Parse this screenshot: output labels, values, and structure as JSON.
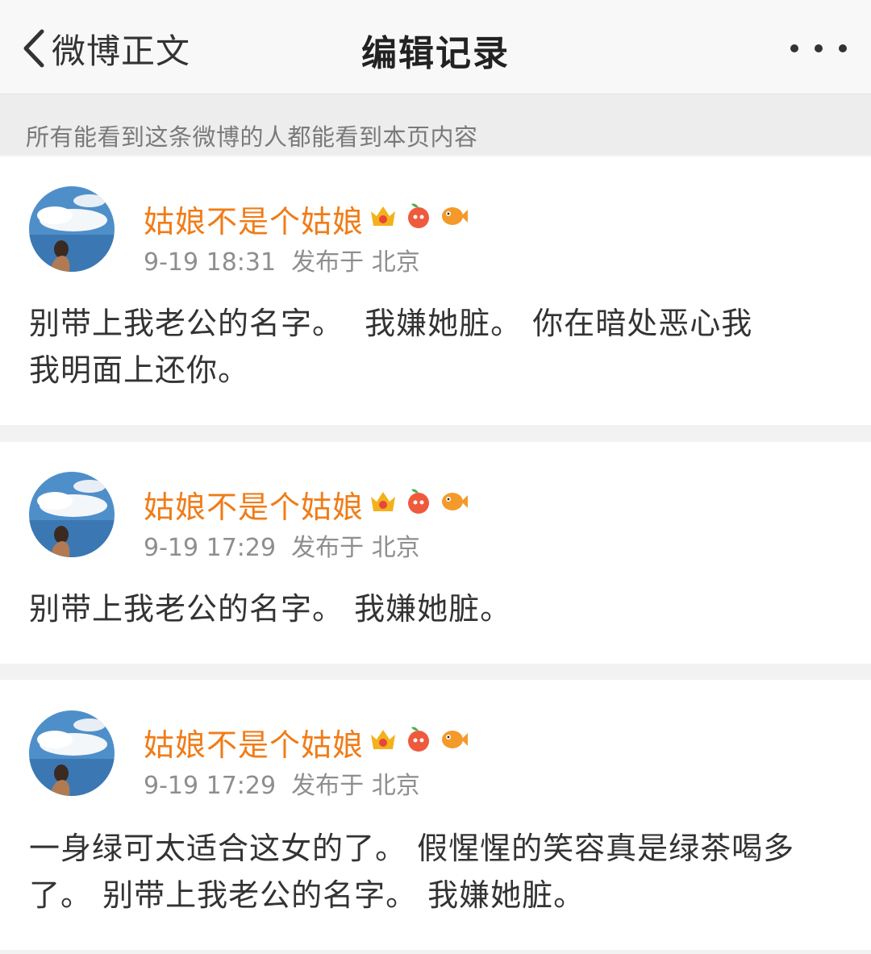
{
  "nav": {
    "back_label": "微博正文",
    "title": "编辑记录"
  },
  "notice": "所有能看到这条微博的人都能看到本页内容",
  "records": [
    {
      "username": "姑娘不是个姑娘",
      "time": "9-19 18:31",
      "location": "发布于 北京",
      "content": "别带上我老公的名字。  我嫌她脏。 你在暗处恶心我\n我明面上还你。"
    },
    {
      "username": "姑娘不是个姑娘",
      "time": "9-19 17:29",
      "location": "发布于 北京",
      "content": "别带上我老公的名字。 我嫌她脏。"
    },
    {
      "username": "姑娘不是个姑娘",
      "time": "9-19 17:29",
      "location": "发布于 北京",
      "content": "一身绿可太适合这女的了。 假惺惺的笑容真是绿茶喝多\n了。 别带上我老公的名字。 我嫌她脏。"
    }
  ],
  "icons": {
    "back": "chevron-left-icon",
    "more": "more-dots-icon",
    "badges": [
      "vip-crown-badge-icon",
      "fruit-badge-icon",
      "fish-badge-icon"
    ]
  },
  "colors": {
    "username": "#f07c18",
    "meta": "#8e8e8e",
    "notice_text": "#7a7a7a"
  }
}
